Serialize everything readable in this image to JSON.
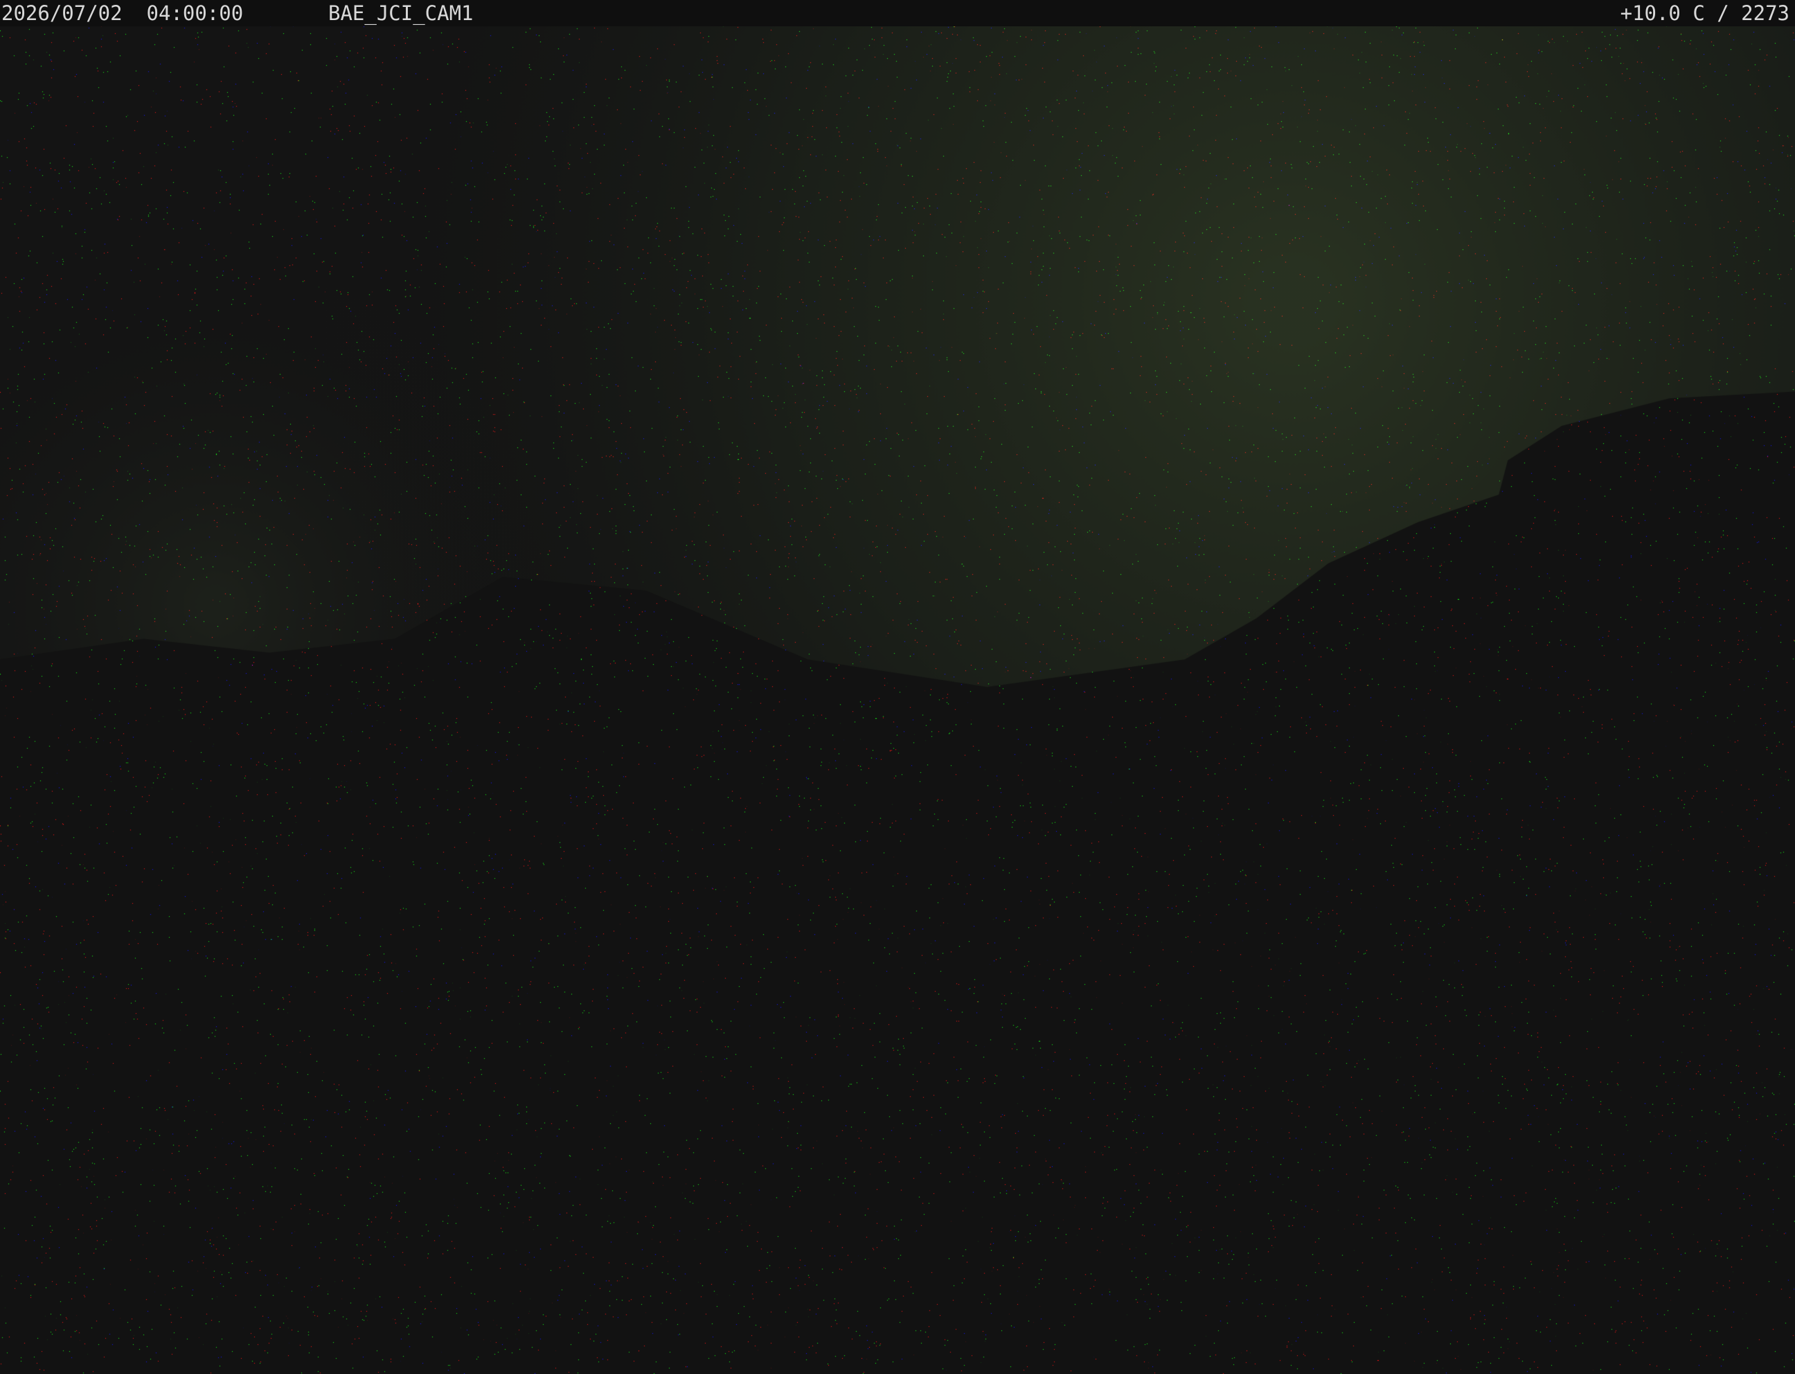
{
  "overlay": {
    "datetime": "2026/07/02  04:00:00",
    "camera_id": "BAE_JCI_CAM1",
    "temp_elevation": "+10.0 C / 2273"
  },
  "scene": {
    "description_colors": {
      "sky_glow": "#3a4a2c",
      "mountain_dark": "#121212",
      "background": "#141414",
      "noise_red": "#a03030",
      "noise_green": "#3f7a35",
      "noise_blue": "#4a4ab0"
    }
  }
}
